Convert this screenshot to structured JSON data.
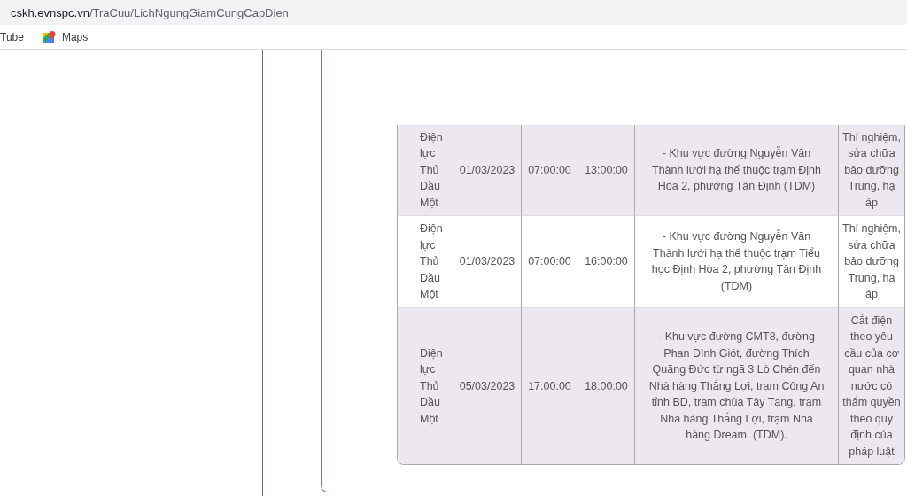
{
  "address_bar": {
    "host": "cskh.evnspc.vn",
    "path": "/TraCuu/LichNgungGiamCungCapDien"
  },
  "bookmarks": [
    {
      "label": "Tube",
      "kind": "plain"
    },
    {
      "label": "Maps",
      "kind": "maps"
    }
  ],
  "table": {
    "rows": [
      {
        "cells": [
          "Điện lực Thủ Dầu Một",
          "01/03/2023",
          "07:00:00",
          "13:00:00",
          "- Khu vực đường Nguyễn Văn Thành lưới hạ thế thuộc trạm Định Hòa 2, phường Tân Định (TDM)",
          "Thí nghiệm, sửa chữa bảo dưỡng Trung, hạ áp"
        ]
      },
      {
        "cells": [
          "Điện lực Thủ Dầu Một",
          "01/03/2023",
          "07:00:00",
          "16:00:00",
          "- Khu vực đường Nguyễn Văn Thành lưới hạ thế thuộc trạm Tiểu học Định Hòa 2, phường Tân Định (TDM)",
          "Thí nghiệm, sửa chữa bảo dưỡng Trung, hạ áp"
        ]
      },
      {
        "cells": [
          "Điện lực Thủ Dầu Một",
          "05/03/2023",
          "17:00:00",
          "18:00:00",
          "- Khu vực đường CMT8, đường Phan Đình Giót, đường Thích Quãng Đức từ ngã 3 Lò Chén đến Nhà hàng Thắng Lợi, trạm Công An tỉnh BD, trạm chùa Tây Tạng, trạm Nhà hàng Thắng Lợi, trạm Nhà hàng Dream. (TDM).",
          "Cắt điện theo yêu cầu của cơ quan nhà nước có thẩm quyền theo quy định của pháp luật"
        ]
      }
    ]
  }
}
